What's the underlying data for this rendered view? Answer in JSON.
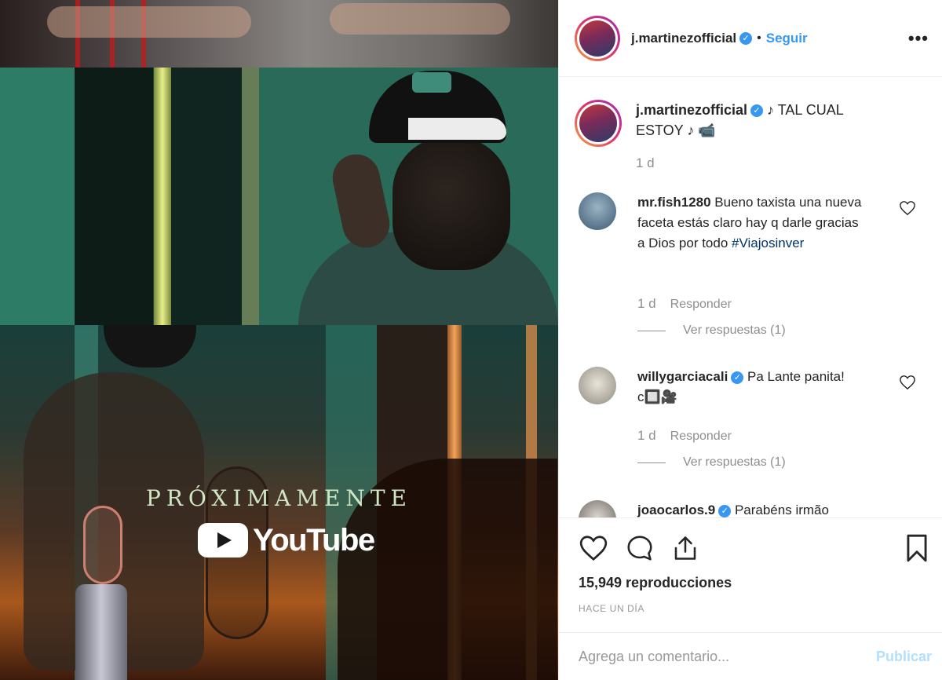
{
  "media": {
    "overlay_title": "PRÓXIMAMENTE",
    "overlay_brand": "YouTube"
  },
  "header": {
    "username": "j.martinezofficial",
    "separator": "•",
    "follow_label": "Seguir",
    "more_label": "•••"
  },
  "caption": {
    "username": "j.martinezofficial",
    "text": " ♪ TAL CUAL ESTOY ♪ 📹",
    "time": "1 d"
  },
  "comments": [
    {
      "username": "mr.fish1280",
      "text": " Bueno taxista una nueva faceta estás claro hay q darle gracias a Dios por todo ",
      "hashtag": "#Viajosinver",
      "time": "1 d",
      "reply_label": "Responder",
      "view_replies": "Ver respuestas (1)",
      "avatar_color": "#5b7d9a"
    },
    {
      "username": "willygarciacali",
      "text": " Pa Lante panita! c🔲🎥",
      "time": "1 d",
      "reply_label": "Responder",
      "view_replies": "Ver respuestas (1)",
      "avatar_color": "#b9b6ad"
    },
    {
      "username": "joaocarlos.9",
      "text": " Parabéns irmão"
    }
  ],
  "actions": {
    "views": "15,949 reproducciones",
    "ago": "HACE UN DÍA"
  },
  "add_comment": {
    "placeholder": "Agrega un comentario...",
    "post_label": "Publicar"
  },
  "colors": {
    "link_blue": "#3897f0",
    "muted": "#8e8e8e",
    "post_disabled": "#b2dffc"
  }
}
